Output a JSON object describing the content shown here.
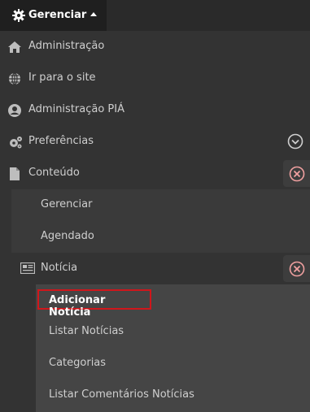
{
  "topbar": {
    "manage_label": "Gerenciar"
  },
  "menu": {
    "items": [
      {
        "label": "Administração",
        "icon": "home-icon"
      },
      {
        "label": "Ir para o site",
        "icon": "globe-icon"
      },
      {
        "label": "Administração PIÁ",
        "icon": "user-icon"
      },
      {
        "label": "Preferências",
        "icon": "gears-icon"
      },
      {
        "label": "Conteúdo",
        "icon": "file-icon"
      }
    ],
    "content_submenu": [
      "Gerenciar",
      "Agendado"
    ],
    "noticia": {
      "label": "Notícia",
      "icon": "newspaper-icon"
    },
    "noticia_submenu": [
      "Adicionar Notícia",
      "Listar Notícias",
      "Categorias",
      "Listar Comentários Notícias"
    ]
  },
  "colors": {
    "highlight": "#d0161b",
    "close_icon": "#f0a0a0"
  }
}
